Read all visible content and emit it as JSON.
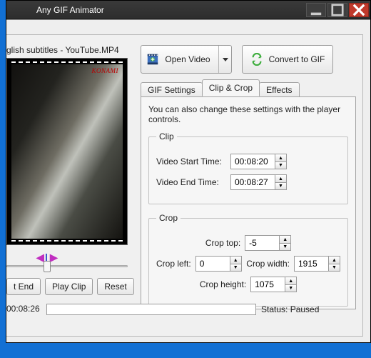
{
  "window": {
    "title": "Any GIF Animator"
  },
  "file_name_fragment": "glish subtitles - YouTube.MP4",
  "preview": {
    "watermark": "KONAMI"
  },
  "transport": {
    "t_end_label": "t End",
    "play_clip_label": "Play Clip",
    "reset_label": "Reset",
    "current_time": "00:08:26"
  },
  "actions": {
    "open_video": "Open Video",
    "convert": "Convert to GIF"
  },
  "tabs": {
    "gif_settings": "GIF Settings",
    "clip_crop": "Clip & Crop",
    "effects": "Effects",
    "active": "clip_crop"
  },
  "clip_crop": {
    "description": "You can also change these settings with the player controls.",
    "clip_legend": "Clip",
    "crop_legend": "Crop",
    "video_start_label": "Video Start Time:",
    "video_end_label": "Video End Time:",
    "video_start": "00:08:20",
    "video_end": "00:08:27",
    "crop_top_label": "Crop top:",
    "crop_left_label": "Crop left:",
    "crop_width_label": "Crop width:",
    "crop_height_label": "Crop height:",
    "crop_top": "-5",
    "crop_left": "0",
    "crop_width": "1915",
    "crop_height": "1075"
  },
  "status": {
    "label": "Status:",
    "value": "Paused"
  }
}
